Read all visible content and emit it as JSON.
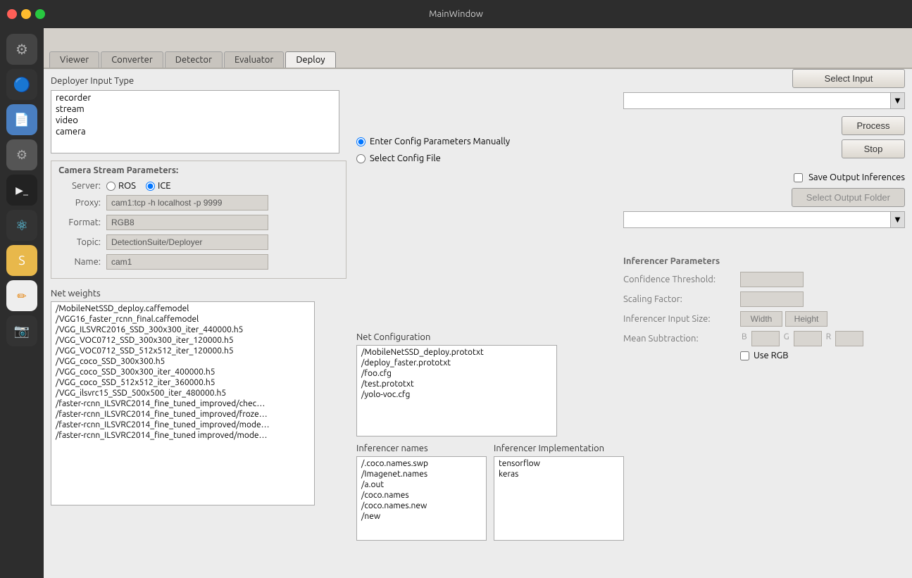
{
  "window": {
    "title": "MainWindow"
  },
  "traffic_lights": {
    "close": "●",
    "min": "●",
    "max": "●"
  },
  "tabs": [
    {
      "label": "Viewer",
      "active": false
    },
    {
      "label": "Converter",
      "active": false
    },
    {
      "label": "Detector",
      "active": false
    },
    {
      "label": "Evaluator",
      "active": false
    },
    {
      "label": "Deploy",
      "active": true
    }
  ],
  "deploy": {
    "section_title": "Deployer Input Type",
    "input_types": [
      "recorder",
      "stream",
      "video",
      "camera"
    ],
    "camera_params_label": "Camera Stream Parameters:",
    "server_label": "Server:",
    "ros_label": "ROS",
    "ice_label": "ICE",
    "proxy_label": "Proxy:",
    "proxy_value": "cam1:tcp -h localhost -p 9999",
    "format_label": "Format:",
    "format_value": "RGB8",
    "topic_label": "Topic:",
    "topic_value": "DetectionSuite/Deployer",
    "name_label": "Name:",
    "name_value": "cam1",
    "enter_config_label": "Enter Config Parameters Manually",
    "select_config_label": "Select Config File",
    "select_input_btn": "Select Input",
    "process_btn": "Process",
    "stop_btn": "Stop",
    "save_output_label": "Save Output Inferences",
    "select_output_btn": "Select Output Folder",
    "net_weights_label": "Net weights",
    "net_weights_items": [
      "/MobileNetSSD_deploy.caffemodel",
      "/VGG16_faster_rcnn_final.caffemodel",
      "/VGG_ILSVRC2016_SSD_300x300_iter_440000.h5",
      "/VGG_VOC0712_SSD_300x300_iter_120000.h5",
      "/VGG_VOC0712_SSD_512x512_iter_120000.h5",
      "/VGG_coco_SSD_300x300.h5",
      "/VGG_coco_SSD_300x300_iter_400000.h5",
      "/VGG_coco_SSD_512x512_iter_360000.h5",
      "/VGG_ilsvrc15_SSD_500x500_iter_480000.h5",
      "/faster-rcnn_ILSVRC2014_fine_tuned_improved/chec…",
      "/faster-rcnn_ILSVRC2014_fine_tuned_improved/froze…",
      "/faster-rcnn_ILSVRC2014_fine_tuned_improved/mode…",
      "/faster-rcnn_ILSVRC2014_fine_tuned improved/mode…"
    ],
    "net_config_label": "Net Configuration",
    "net_config_items": [
      "/MobileNetSSD_deploy.prototxt",
      "/deploy_faster.prototxt",
      "/foo.cfg",
      "/test.prototxt",
      "/yolo-voc.cfg"
    ],
    "inferencer_names_label": "Inferencer names",
    "inferencer_names_items": [
      "/.coco.names.swp",
      "/Imagenet.names",
      "/a.out",
      "/coco.names",
      "/coco.names.new",
      "/new"
    ],
    "inferencer_impl_label": "Inferencer Implementation",
    "inferencer_impl_items": [
      "tensorflow",
      "keras"
    ],
    "inferencer_params_title": "Inferencer Parameters",
    "confidence_threshold_label": "Confidence Threshold:",
    "scaling_factor_label": "Scaling Factor:",
    "inferencer_input_size_label": "Inferencer Input Size:",
    "width_label": "Width",
    "height_label": "Height",
    "mean_subtraction_label": "Mean Subtraction:",
    "b_label": "B",
    "g_label": "G",
    "r_label": "R",
    "use_rgb_label": "Use RGB"
  },
  "dock_icons": [
    {
      "name": "settings-icon",
      "char": "⚙",
      "color": "#888"
    },
    {
      "name": "chrome-icon",
      "char": "◉",
      "color": "#4285f4"
    },
    {
      "name": "files-icon",
      "char": "📁",
      "color": "#5b8ee6"
    },
    {
      "name": "system-icon",
      "char": "⚙",
      "color": "#888"
    },
    {
      "name": "terminal-icon",
      "char": "▶",
      "color": "#eee"
    },
    {
      "name": "code-icon",
      "char": "⚛",
      "color": "#61dafb"
    },
    {
      "name": "pencil-icon",
      "char": "✏",
      "color": "#eee"
    },
    {
      "name": "sketch-icon",
      "char": "✏",
      "color": "#aaa"
    },
    {
      "name": "camera2-icon",
      "char": "📷",
      "color": "#eee"
    }
  ]
}
